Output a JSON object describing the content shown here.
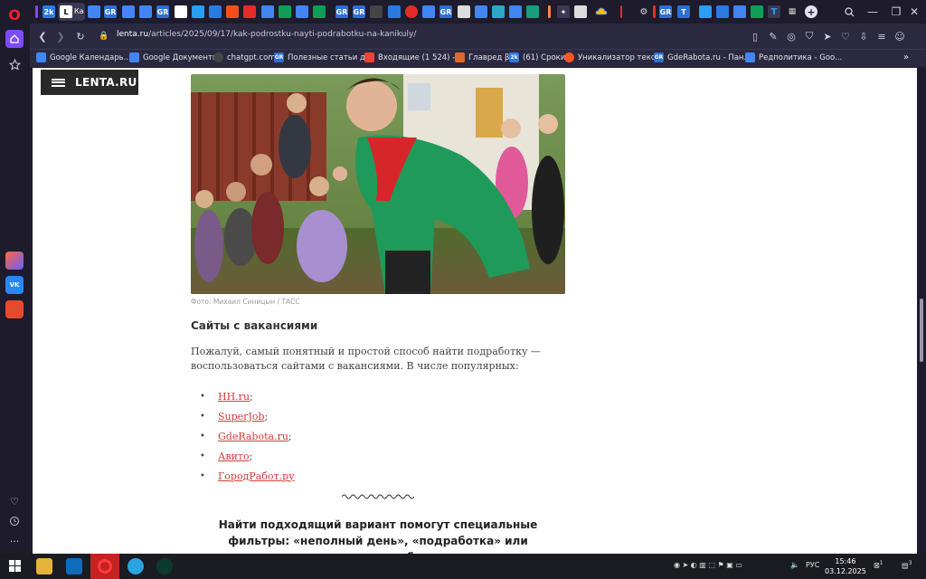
{
  "browser": {
    "url_host": "lenta.ru",
    "url_path": "/articles/2025/09/17/kak-podrostku-nayti-podrabotku-na-kanikuly/",
    "tab_labels": [
      "2k",
      "Ка",
      "GR",
      "GR",
      "GR",
      "GR",
      "GR",
      "GR",
      "T"
    ],
    "bookmarks": [
      {
        "label": "Google Календарь...",
        "color": "#4285f4"
      },
      {
        "label": "Google Документы",
        "color": "#4285f4"
      },
      {
        "label": "chatgpt.com",
        "color": "#444444"
      },
      {
        "label": "Полезные статьи д...",
        "color": "#2d6fd6"
      },
      {
        "label": "Входящие (1 524) -...",
        "color": "#ea4335"
      },
      {
        "label": "Главред β",
        "color": "#e0692b"
      },
      {
        "label": "(61) Сроки",
        "color": "#2a7ae2"
      },
      {
        "label": "Уникализатор текс...",
        "color": "#ff5722"
      },
      {
        "label": "GdeRabota.ru - Пан...",
        "color": "#2d6fd6"
      },
      {
        "label": "Редполитика - Goo...",
        "color": "#4285f4"
      }
    ],
    "bookmark_icon_texts": [
      "",
      "",
      "",
      "GR",
      "",
      "",
      "2k",
      "",
      "GR",
      ""
    ]
  },
  "site": {
    "logo": "LENTA.RU"
  },
  "article": {
    "photo_caption": "Фото: Михаил Синицын / ТАСС",
    "section_title": "Сайты с вакансиями",
    "paragraph": "Пожалуй, самый понятный и простой способ найти подработку — воспользоваться сайтами с вакансиями. В числе популярных:",
    "links": [
      {
        "text": "HH.ru",
        "suffix": ";"
      },
      {
        "text": "SuperJob",
        "suffix": ";"
      },
      {
        "text": "GdeRabota.ru",
        "suffix": ";"
      },
      {
        "text": "Авито",
        "suffix": ";"
      },
      {
        "text": "ГородРабот.ру",
        "suffix": ""
      }
    ],
    "quote": "Найти подходящий вариант помогут специальные фильтры: «неполный день», «подработка» или «временная работа»"
  },
  "taskbar": {
    "lang": "РУС",
    "time": "15:46",
    "date": "03.12.2025",
    "badges": [
      "1",
      "3"
    ]
  }
}
